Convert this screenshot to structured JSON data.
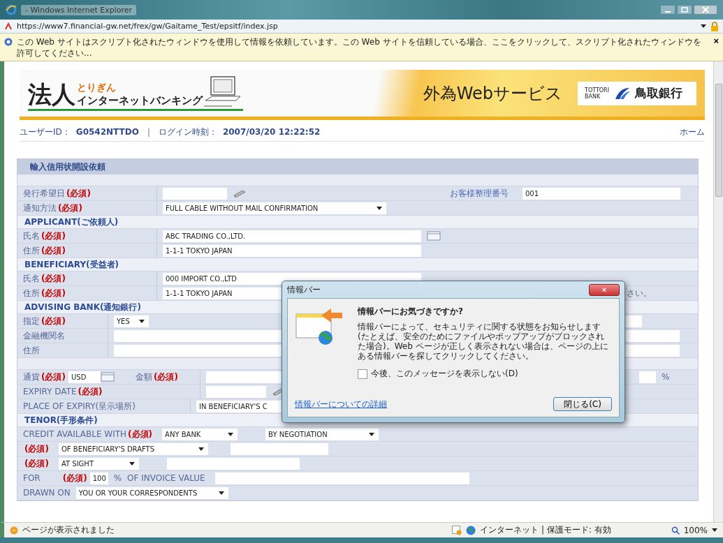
{
  "window": {
    "title": "- Windows Internet Explorer"
  },
  "address_bar": {
    "url": "https://www7.financial-gw.net/frex/gw/Gaitame_Test/epsitf/index.jsp"
  },
  "info_bar": {
    "text": "この Web サイトはスクリプト化されたウィンドウを使用して情報を依頼しています。この Web サイトを信頼している場合、ここをクリックして、スクリプト化されたウィンドウを許可してください...",
    "close": "×"
  },
  "banner": {
    "logo_main": "法人",
    "logo_sub": "とりぎん",
    "logo_text": "インターネットバンキング",
    "service": "外為Webサービス",
    "bank_en": "TOTTORI BANK",
    "bank_name": "鳥取銀行"
  },
  "user_bar": {
    "user_id_label": "ユーザーID：",
    "user_id": "G0542NTTDO",
    "separator": "｜",
    "login_label": "ログイン時刻：",
    "login_time": "2007/03/20 12:22:52",
    "home_link": "ホーム"
  },
  "form": {
    "title": "輸入信用状開設依頼",
    "issue_date": {
      "label": "発行希望日",
      "mark": "(必須)"
    },
    "customer_ref": {
      "label": "お客様整理番号",
      "value": "001"
    },
    "notify_method": {
      "label": "通知方法",
      "mark": "(必須)",
      "value": "FULL CABLE WITHOUT MAIL CONFIRMATION"
    },
    "applicant": {
      "heading": "APPLICANT(ご依頼人)",
      "name": {
        "label": "氏名",
        "mark": "(必須)",
        "value": "ABC TRADING CO.,LTD."
      },
      "address": {
        "label": "住所",
        "mark": "(必須)",
        "value": "1-1-1 TOKYO JAPAN"
      }
    },
    "beneficiary": {
      "heading": "BENEFICIARY(受益者)",
      "name": {
        "label": "氏名",
        "mark": "(必須)",
        "value": "000 IMPORT CO.,LTD"
      },
      "address": {
        "label": "住所",
        "mark": "(必須)",
        "value": "1-1-1 TOKYO JAPAN"
      },
      "note": "さい。"
    },
    "advising_bank": {
      "heading": "ADVISING BANK(通知銀行)",
      "designate": {
        "label": "指定",
        "mark": "(必須)",
        "value": "YES"
      },
      "institution": {
        "label": "金融機関名"
      },
      "address": {
        "label": "住所"
      }
    },
    "currency": {
      "label": "通貨",
      "mark": "(必須)",
      "value": "USD"
    },
    "amount": {
      "label": "金額",
      "mark": "(必須)",
      "unit": "%"
    },
    "expiry_date": {
      "label": "EXPIRY DATE",
      "mark": "(必須)"
    },
    "expiry_place": {
      "label": "PLACE OF EXPIRY(呈示場所)",
      "value": "IN BENEFICIARY'S C"
    },
    "tenor": {
      "heading": "TENOR(手形条件)",
      "credit_available": {
        "label": "CREDIT AVAILABLE WITH",
        "mark": "(必須)",
        "bank": "ANY BANK",
        "method": "BY NEGOTIATION"
      },
      "drafts": {
        "mark": "(必須)",
        "value": "OF BENEFICIARY'S DRAFTS"
      },
      "sight": {
        "mark": "(必須)",
        "value": "AT SIGHT"
      },
      "for": {
        "label": "FOR",
        "mark": "(必須)",
        "value": "100",
        "unit": "%",
        "suffix": "OF INVOICE VALUE"
      },
      "drawn_on": {
        "label": "DRAWN ON",
        "value": "YOU OR YOUR CORRESPONDENTS"
      }
    }
  },
  "dialog": {
    "title": "情報バー",
    "close": "×",
    "heading": "情報バーにお気づきですか?",
    "body": "情報バーによって、セキュリティに関する状態をお知らせします (たとえば、安全のためにファイルやポップアップがブロックされた場合)。Web ページが正しく表示されない場合は、ページの上にある情報バーを探してクリックしてください。",
    "checkbox": {
      "label": "今後、このメッセージを表示しない(D)",
      "checked": false
    },
    "link": "情報バーについての詳細",
    "button": "閉じる(C)"
  },
  "status_bar": {
    "text": "ページが表示されました",
    "zone": "インターネット | 保護モード: 有効",
    "zoom": "100%"
  }
}
